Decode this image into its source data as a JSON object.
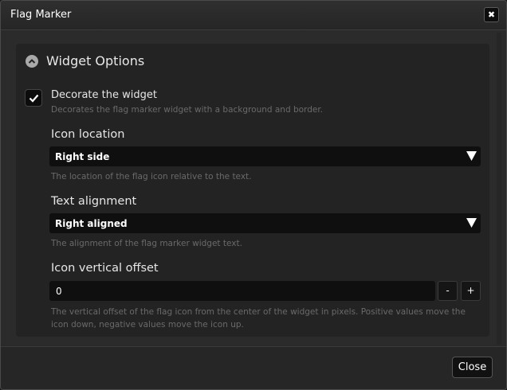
{
  "window": {
    "title": "Flag Marker",
    "close_glyph": "✖"
  },
  "section": {
    "title": "Widget Options",
    "collapse_icon": "chevron-up-circle-icon"
  },
  "decorate": {
    "label": "Decorate the widget",
    "checked": true,
    "description": "Decorates the flag marker widget with a background and border."
  },
  "icon_location": {
    "label": "Icon location",
    "value": "Right side",
    "description": "The location of the flag icon relative to the text."
  },
  "text_alignment": {
    "label": "Text alignment",
    "value": "Right aligned",
    "description": "The alignment of the flag marker widget text."
  },
  "icon_offset": {
    "label": "Icon vertical offset",
    "value": "0",
    "minus": "-",
    "plus": "+",
    "description": "The vertical offset of the flag icon from the center of the widget in pixels. Positive values move the icon down, negative values move the icon up."
  },
  "footer": {
    "close_label": "Close"
  },
  "colors": {
    "background": "#2a2a2a",
    "panel": "#232323",
    "input": "#0f0f0f",
    "muted_text": "#6a6a6a"
  }
}
